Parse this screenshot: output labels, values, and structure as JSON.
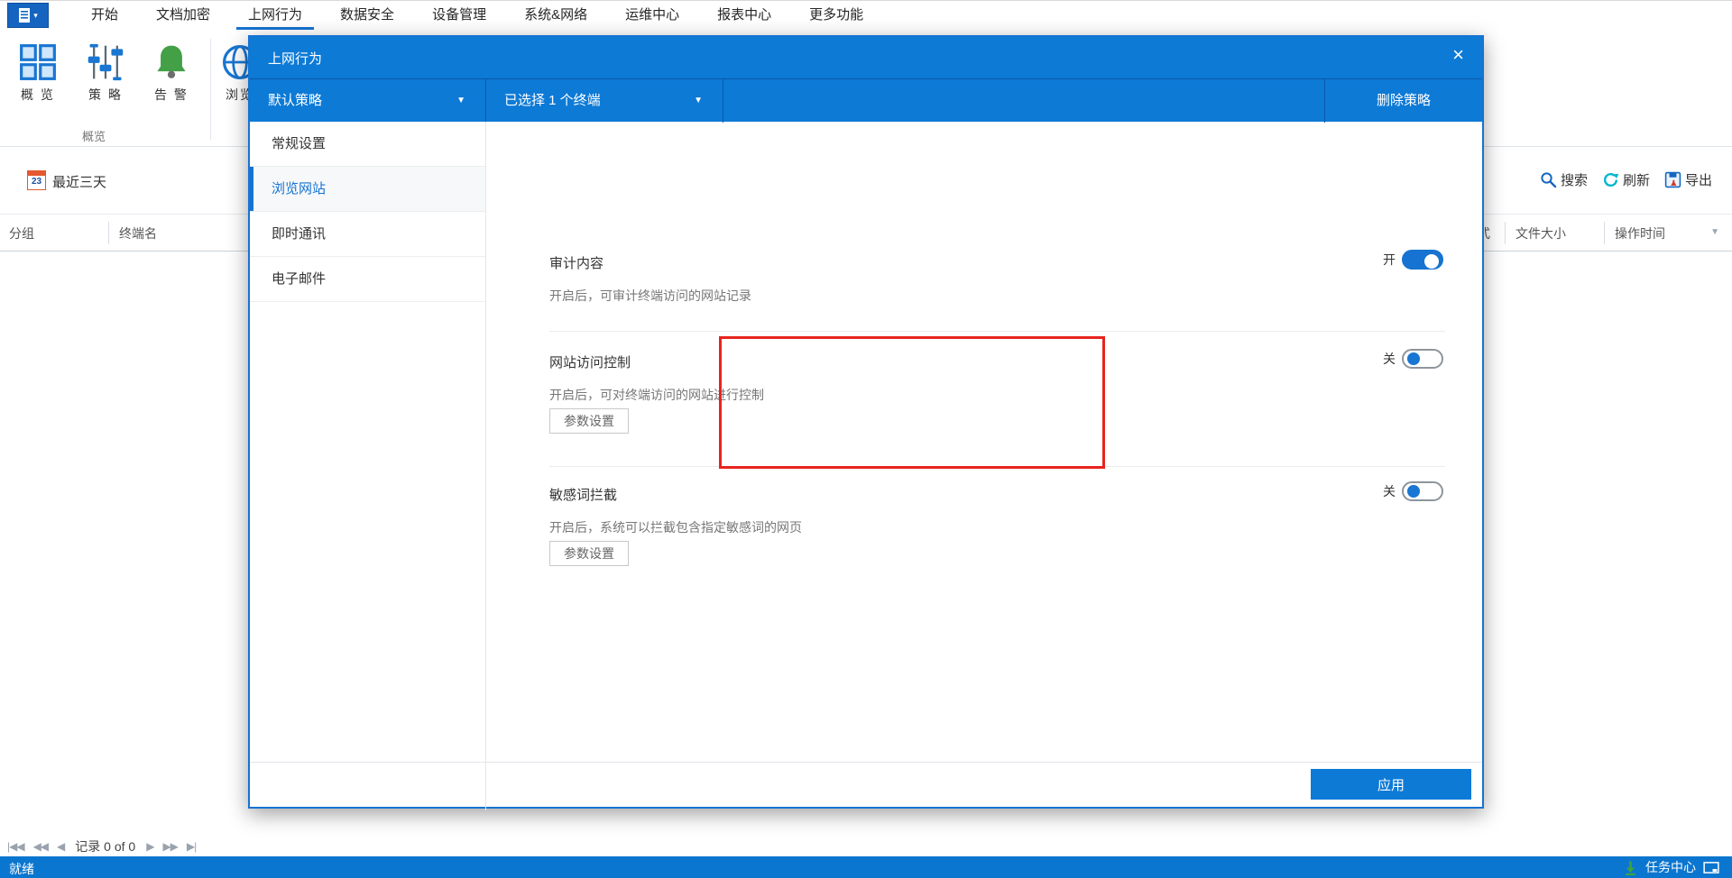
{
  "menubar": {
    "items": [
      {
        "label": "开始",
        "active": false
      },
      {
        "label": "文档加密",
        "active": false
      },
      {
        "label": "上网行为",
        "active": true
      },
      {
        "label": "数据安全",
        "active": false
      },
      {
        "label": "设备管理",
        "active": false
      },
      {
        "label": "系统&网络",
        "active": false
      },
      {
        "label": "运维中心",
        "active": false
      },
      {
        "label": "报表中心",
        "active": false
      },
      {
        "label": "更多功能",
        "active": false
      }
    ],
    "app_caret": "▾"
  },
  "ribbon": {
    "tools": [
      {
        "label": "概 览",
        "icon": "overview-grid-icon"
      },
      {
        "label": "策 略",
        "icon": "policy-sliders-icon"
      },
      {
        "label": "告 警",
        "icon": "alert-bell-icon"
      },
      {
        "label": "浏览",
        "icon": "browse-globe-icon"
      }
    ],
    "group_label": "概览"
  },
  "content": {
    "date_filter": {
      "icon_day": "23",
      "label": "最近三天"
    },
    "actions": {
      "search": "搜索",
      "refresh": "刷新",
      "export": "导出"
    },
    "table": {
      "left_columns": [
        "分组",
        "终端名"
      ],
      "clipped_column_fragment": "式",
      "right_columns": [
        "文件大小",
        "操作时间"
      ],
      "sort_caret": "▼"
    },
    "pagination": {
      "first": "|◀◀",
      "fast_prev": "◀◀",
      "prev": "◀",
      "label": "记录 0 of 0",
      "next": "▶",
      "fast_next": "▶▶",
      "last": "▶|"
    }
  },
  "statusbar": {
    "left": "就绪",
    "task_center": "任务中心"
  },
  "modal": {
    "title": "上网行为",
    "close_icon": "×",
    "toolbar": {
      "policy_dropdown": "默认策略",
      "terminal_dropdown": "已选择 1 个终端",
      "caret": "▼",
      "delete_button": "删除策略"
    },
    "sidebar": {
      "items": [
        {
          "label": "常规设置",
          "active": false
        },
        {
          "label": "浏览网站",
          "active": true
        },
        {
          "label": "即时通讯",
          "active": false
        },
        {
          "label": "电子邮件",
          "active": false
        }
      ]
    },
    "sections": [
      {
        "title": "审计内容",
        "description": "开启后，可审计终端访问的网站记录",
        "toggle_label": "开",
        "toggle_state": "on"
      },
      {
        "title": "网站访问控制",
        "description": "开启后，可对终端访问的网站进行控制",
        "toggle_label": "关",
        "toggle_state": "off",
        "button_label": "参数设置",
        "highlighted": true
      },
      {
        "title": "敏感词拦截",
        "description": "开启后，系统可以拦截包含指定敏感词的网页",
        "toggle_label": "关",
        "toggle_state": "off",
        "button_label": "参数设置",
        "highlighted": false
      }
    ],
    "apply_button": "应用"
  },
  "colors": {
    "accent_blue": "#0d7ad6",
    "toggle_on_blue": "#1673d1",
    "highlight_red": "#e8231d",
    "alert_green": "#43a047",
    "refresh_teal": "#00b5cc",
    "statusbar_blue": "#0b76cf"
  }
}
